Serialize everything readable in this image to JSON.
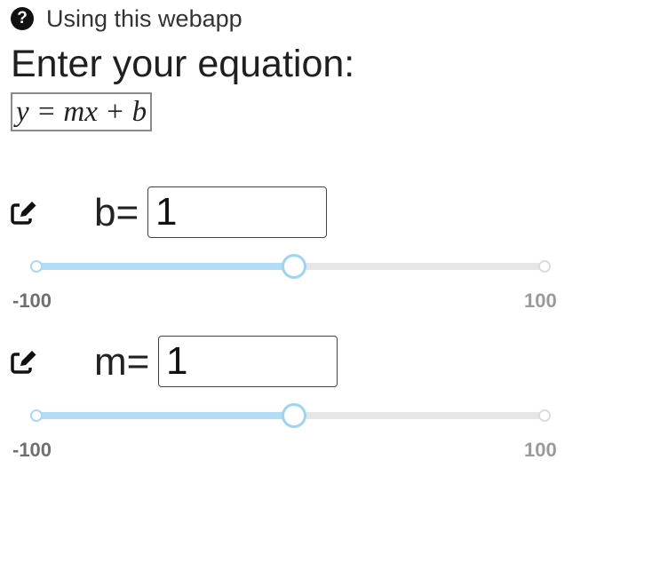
{
  "help": {
    "icon": "question-circle-icon",
    "label": "Using this webapp"
  },
  "title": "Enter your equation:",
  "equation": "y = mx + b",
  "params": [
    {
      "name": "b",
      "label": "b=",
      "value": "1",
      "min_label": "-100",
      "max_label": "100",
      "min": -100,
      "max": 100,
      "slider_value": 1
    },
    {
      "name": "m",
      "label": "m=",
      "value": "1",
      "min_label": "-100",
      "max_label": "100",
      "min": -100,
      "max": 100,
      "slider_value": 1
    }
  ],
  "colors": {
    "slider_fill": "#b3dcf5",
    "slider_track": "#e6e6e6",
    "slider_handle_border": "#9fd3f3"
  }
}
